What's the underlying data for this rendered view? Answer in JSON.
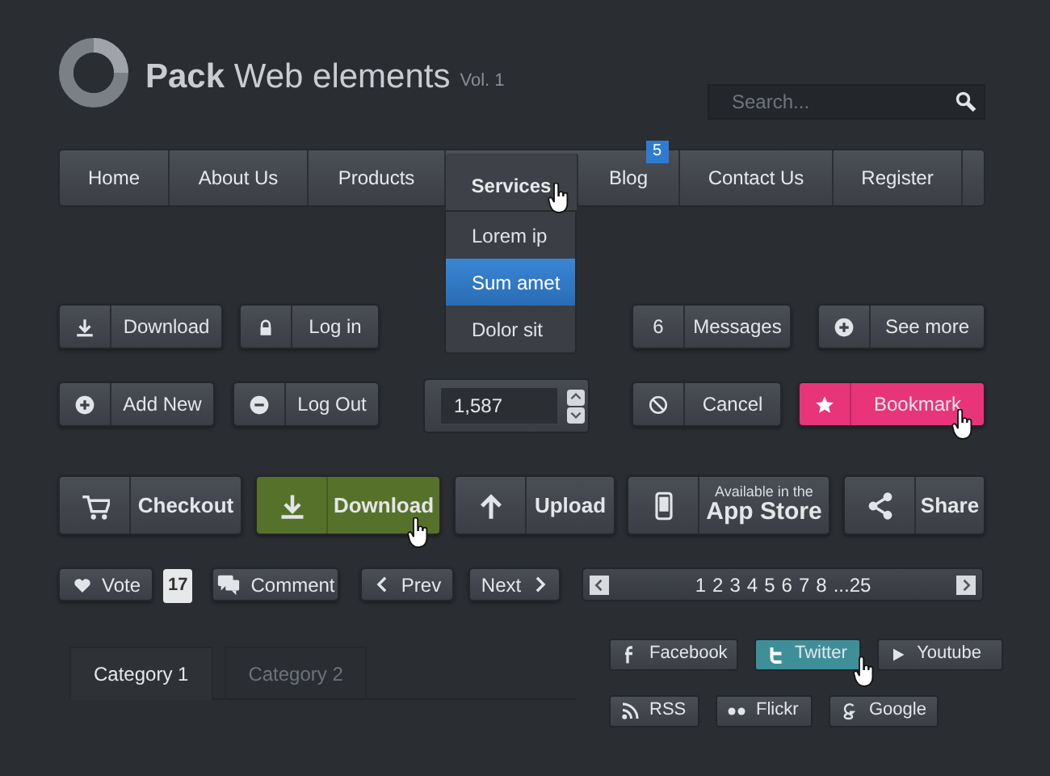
{
  "logo": {
    "title": "**Pack** Web elements",
    "subtitle": "Vol. 1"
  },
  "search": {
    "placeholder": "Search..."
  },
  "nav": [
    {
      "label": "Home",
      "selected": false,
      "hovered": false
    },
    {
      "label": "About Us",
      "selected": false,
      "hovered": false
    },
    {
      "label": "Products",
      "selected": false,
      "hovered": false
    },
    {
      "label": "Services",
      "selected": true,
      "hovered": true
    },
    {
      "label": "Blog",
      "selected": false,
      "hovered": false,
      "badge": "5"
    },
    {
      "label": "Contact Us",
      "selected": false,
      "hovered": false
    },
    {
      "label": "Register",
      "selected": false,
      "hovered": false
    }
  ],
  "dropdown": [
    {
      "label": "Lorem ip",
      "selected": false
    },
    {
      "label": "Sum amet",
      "selected": true
    },
    {
      "label": "Dolor sit",
      "selected": false
    }
  ],
  "button_rows": [
    [
      {
        "kind": "icon-button",
        "label": "Download",
        "hovered": false
      },
      {
        "kind": "icon-button",
        "label": "Log in",
        "hovered": false
      },
      {
        "kind": "count-button",
        "count": "6",
        "label": "Messages",
        "hovered": false
      },
      {
        "kind": "icon-button",
        "label": "See more",
        "hovered": false
      }
    ],
    [
      {
        "kind": "icon-button",
        "label": "Add New",
        "hovered": false
      },
      {
        "kind": "icon-button",
        "label": "Log Out",
        "hovered": false
      },
      {
        "kind": "spinner",
        "value": "1,587"
      },
      {
        "kind": "icon-button",
        "label": "Cancel",
        "hovered": false
      },
      {
        "kind": "icon-button",
        "label": "Bookmark",
        "hovered": true,
        "color": "#e8357a"
      }
    ],
    [
      {
        "kind": "big-button",
        "label": "Checkout",
        "hovered": false
      },
      {
        "kind": "big-button",
        "label": "Download",
        "hovered": true,
        "color": "#56722a"
      },
      {
        "kind": "big-button",
        "label": "Upload",
        "hovered": false
      },
      {
        "kind": "app-store",
        "caption": "Available in the",
        "label": "App Store",
        "hovered": false
      },
      {
        "kind": "big-button",
        "label": "Share",
        "hovered": false
      }
    ],
    [
      {
        "kind": "vote",
        "label": "Vote",
        "count": "17",
        "hovered": false
      },
      {
        "kind": "text-button",
        "label": "Comment",
        "hovered": false
      },
      {
        "kind": "text-button",
        "label": "Prev",
        "hovered": false
      },
      {
        "kind": "text-button",
        "label": "Next",
        "hovered": false
      },
      {
        "kind": "pagination",
        "pages": [
          "1",
          "2",
          "3",
          "4",
          "5",
          "6",
          "7",
          "8",
          "...25"
        ]
      }
    ]
  ],
  "tabs": [
    {
      "label": "Category 1",
      "selected": true
    },
    {
      "label": "Category 2",
      "selected": false
    }
  ],
  "social": [
    {
      "label": "Facebook",
      "hovered": false
    },
    {
      "label": "Twitter",
      "hovered": true,
      "color": "#3f8f9a"
    },
    {
      "label": "Youtube",
      "hovered": false
    },
    {
      "label": "RSS",
      "hovered": false
    },
    {
      "label": "Flickr",
      "hovered": false
    },
    {
      "label": "Google",
      "hovered": false
    }
  ]
}
